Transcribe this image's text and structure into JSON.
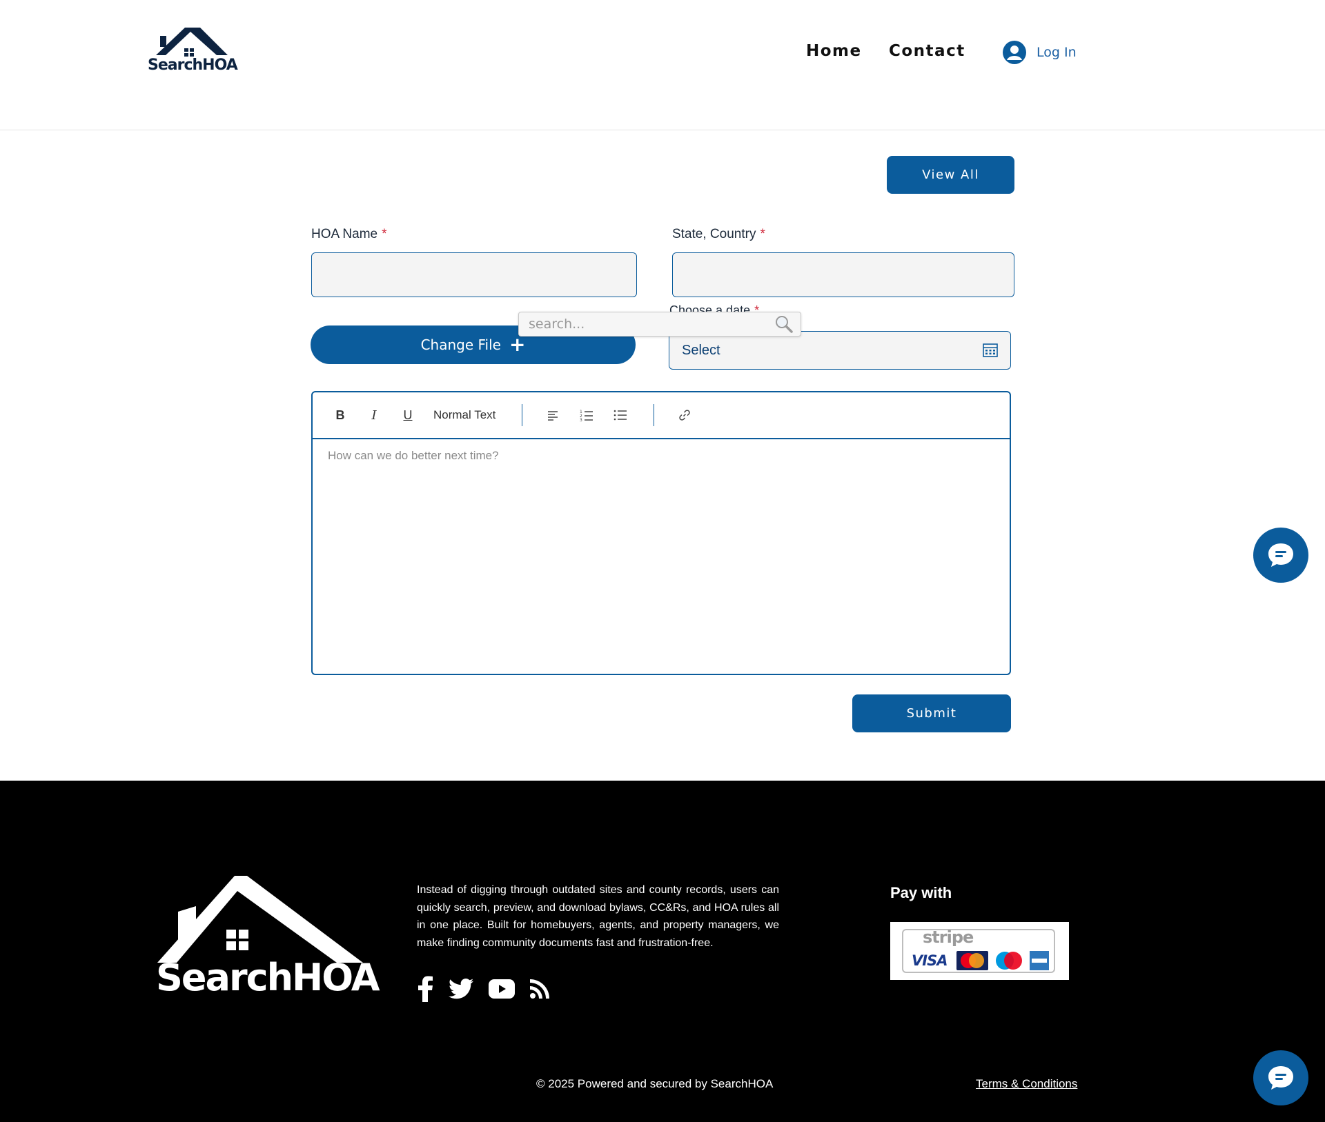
{
  "header": {
    "logo_text": "SearchHOA",
    "nav": {
      "home": "Home",
      "contact": "Contact"
    },
    "login_label": "Log In"
  },
  "actions": {
    "view_all_label": "View All",
    "submit_label": "Submit"
  },
  "form": {
    "hoa_name": {
      "label": "HOA Name",
      "required_mark": "*",
      "value": ""
    },
    "state_country": {
      "label": "State, Country",
      "required_mark": "*",
      "value": ""
    },
    "change_file_label": "Change File",
    "date": {
      "label": "Choose a date",
      "required_mark": "*",
      "selected": "Select"
    },
    "search_overlay_placeholder": "search...",
    "editor": {
      "toolbar": {
        "bold": "B",
        "italic": "I",
        "underline": "U",
        "text_style": "Normal Text"
      },
      "placeholder": "How can we do better next time?"
    }
  },
  "footer": {
    "logo_text": "SearchHOA",
    "description": "Instead of digging through outdated sites and county records, users can quickly search, preview, and download bylaws, CC&Rs, and HOA rules all in one place. Built for homebuyers, agents, and property managers, we make finding community documents fast and frustration-free.",
    "pay_title": "Pay with",
    "payment": {
      "stripe": "stripe",
      "visa": "VISA"
    },
    "socials": [
      "facebook-icon",
      "twitter-icon",
      "youtube-icon",
      "rss-icon"
    ],
    "copyright": "© 2025 Powered and secured by SearchHOA",
    "terms_label": "Terms & Conditions"
  },
  "colors": {
    "brand_blue": "#0b5c9c",
    "navy": "#0d2340",
    "required": "#d0283a",
    "footer_bg": "#000000"
  }
}
